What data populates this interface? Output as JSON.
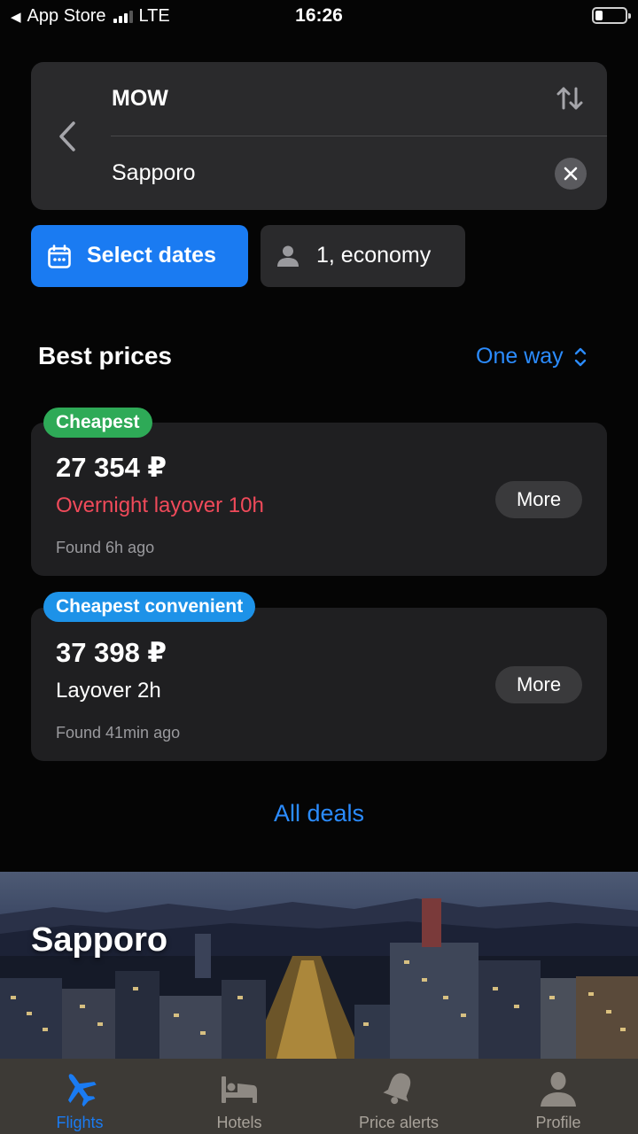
{
  "status_bar": {
    "back_app": "App Store",
    "network": "LTE",
    "time": "16:26"
  },
  "route": {
    "origin": "MOW",
    "destination": "Sapporo"
  },
  "filters": {
    "dates_label": "Select dates",
    "passengers_label": "1, economy"
  },
  "best_prices": {
    "title": "Best prices",
    "trip_type": "One way",
    "offers": [
      {
        "badge": "Cheapest",
        "price": "27 354 ₽",
        "layover": "Overnight layover 10h",
        "found": "Found 6h ago",
        "more_label": "More"
      },
      {
        "badge": "Cheapest convenient",
        "price": "37 398 ₽",
        "layover": "Layover 2h",
        "found": "Found 41min ago",
        "more_label": "More"
      }
    ],
    "all_deals": "All deals"
  },
  "destination_banner": {
    "city": "Sapporo"
  },
  "tab_bar": {
    "tabs": [
      {
        "label": "Flights",
        "icon": "airplane-icon",
        "active": true
      },
      {
        "label": "Hotels",
        "icon": "bed-icon",
        "active": false
      },
      {
        "label": "Price alerts",
        "icon": "bell-icon",
        "active": false
      },
      {
        "label": "Profile",
        "icon": "person-icon",
        "active": false
      }
    ]
  },
  "colors": {
    "accent": "#1a7bf2",
    "link": "#2b8cff",
    "badge_cheapest": "#2eaa57",
    "badge_convenient": "#1d92e8",
    "warning_text": "#f04a5a"
  }
}
